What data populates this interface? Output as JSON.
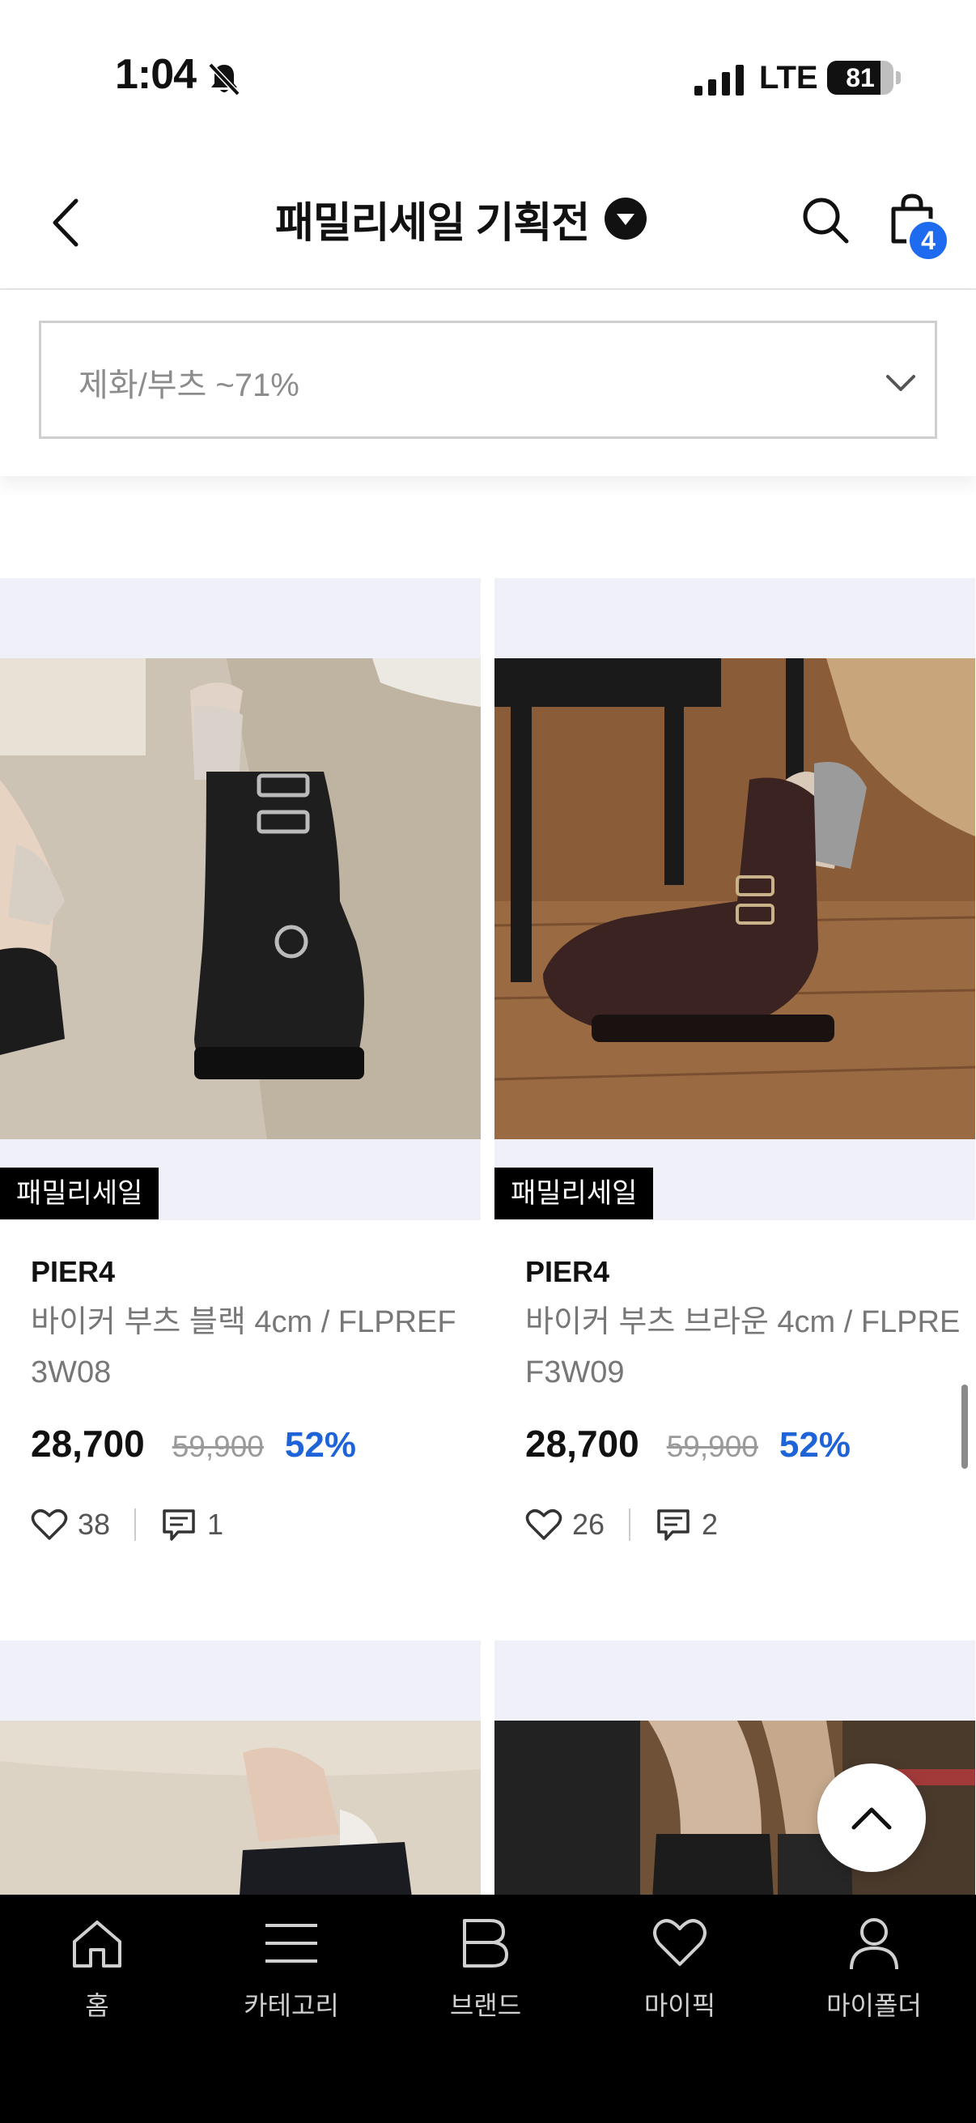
{
  "status_bar": {
    "time": "1:04",
    "network": "LTE",
    "battery": "81",
    "battery_level": 0.81
  },
  "header": {
    "title": "패밀리세일 기획전",
    "cart_count": "4"
  },
  "filter": {
    "selected": "제화/부츠 ~71%"
  },
  "products": [
    {
      "tag": "패밀리세일",
      "brand": "PIER4",
      "name": "바이커 부츠 블랙 4cm / FLPREF3W08",
      "price": "28,700",
      "original_price": "59,900",
      "discount": "52%",
      "likes": "38",
      "reviews": "1"
    },
    {
      "tag": "패밀리세일",
      "brand": "PIER4",
      "name": "바이커 부츠 브라운 4cm / FLPREF3W09",
      "price": "28,700",
      "original_price": "59,900",
      "discount": "52%",
      "likes": "26",
      "reviews": "2"
    }
  ],
  "bottom_nav": [
    {
      "label": "홈",
      "icon": "home-icon"
    },
    {
      "label": "카테고리",
      "icon": "menu-icon"
    },
    {
      "label": "브랜드",
      "icon": "brand-b-icon"
    },
    {
      "label": "마이픽",
      "icon": "heart-icon"
    },
    {
      "label": "마이폴더",
      "icon": "person-icon"
    }
  ],
  "colors": {
    "accent": "#1e6bf0",
    "discount": "#1e63d8",
    "tag_bg": "#000000",
    "card_bg": "#f0f1f8"
  }
}
